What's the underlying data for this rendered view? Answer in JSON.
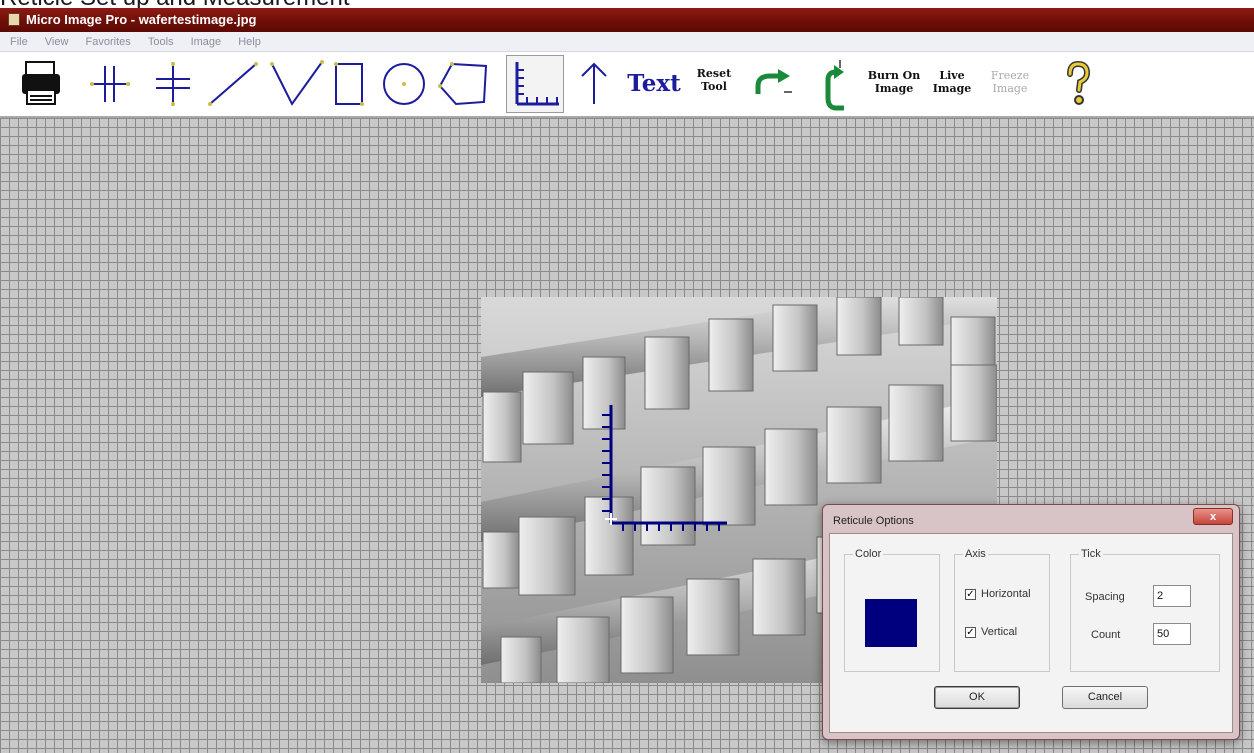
{
  "slide_title": "Reticle Set up and Measurement",
  "window": {
    "title": "Micro Image Pro - wafertestimage.jpg"
  },
  "menu": [
    "File",
    "View",
    "Favorites",
    "Tools",
    "Image",
    "Help"
  ],
  "toolbar": {
    "text_tool": "Text",
    "reset_tool": [
      "Reset",
      "Tool"
    ],
    "burn_on_image": [
      "Burn On",
      "Image"
    ],
    "live_image": [
      "Live",
      "Image"
    ],
    "freeze_image": [
      "Freeze",
      "Image"
    ]
  },
  "dialog": {
    "title": "Reticule Options",
    "color_group": "Color",
    "color_value": "#00007f",
    "axis_group": "Axis",
    "horizontal_label": "Horizontal",
    "horizontal_checked": true,
    "vertical_label": "Vertical",
    "vertical_checked": true,
    "tick_group": "Tick",
    "spacing_label": "Spacing",
    "spacing_value": "2",
    "count_label": "Count",
    "count_value": "50",
    "ok_label": "OK",
    "cancel_label": "Cancel",
    "close_label": "x"
  },
  "colors": {
    "titlebar": "#6e0e08",
    "reticle": "#00007f",
    "grid_background": "#c8c8c8"
  },
  "icons": [
    "printer-icon",
    "parallel-lines-icon",
    "perpendicular-lines-icon",
    "line-icon",
    "angle-icon",
    "rectangle-icon",
    "circle-icon",
    "polygon-icon",
    "reticle-icon",
    "arrow-icon",
    "undo-icon",
    "redo-icon",
    "help-icon"
  ]
}
